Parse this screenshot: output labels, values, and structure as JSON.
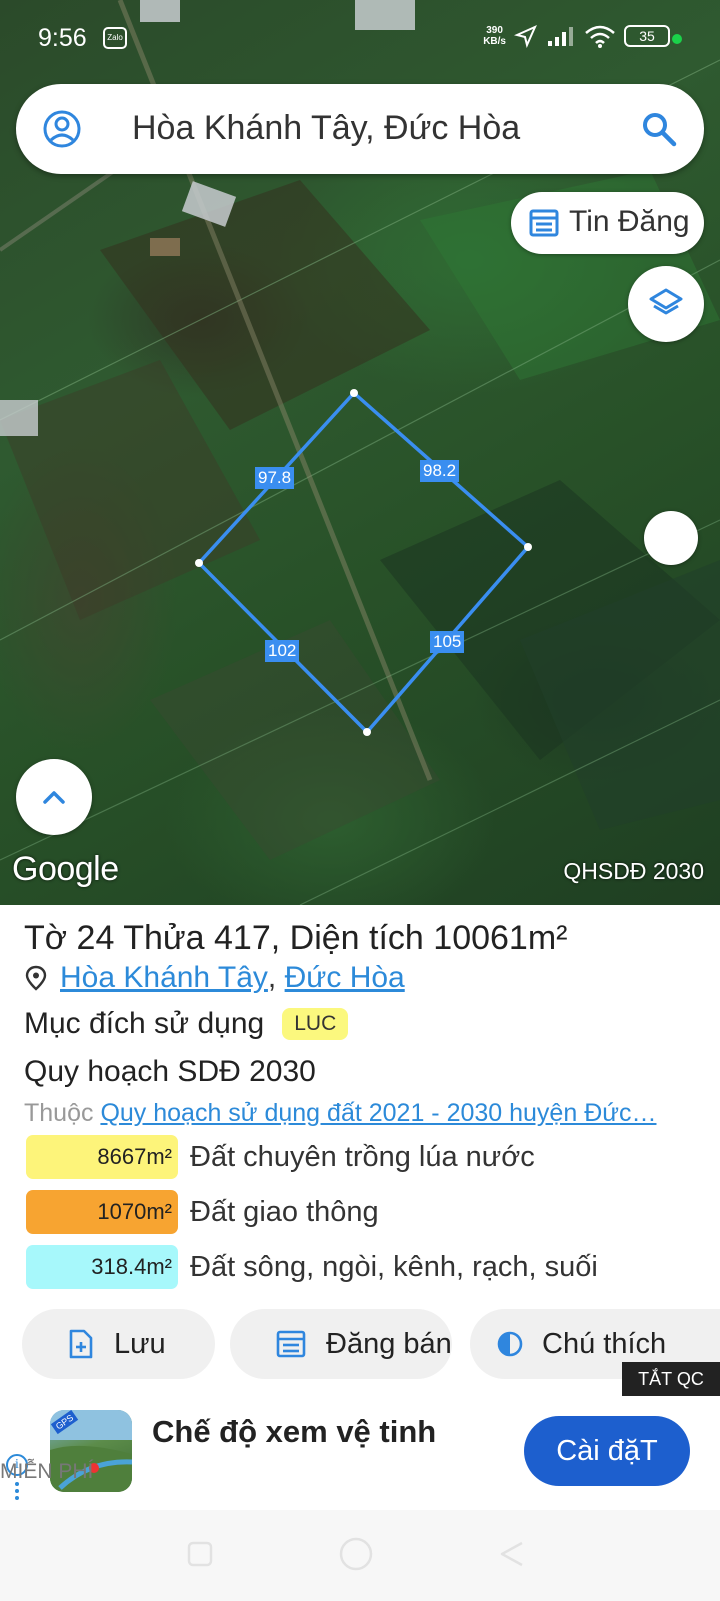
{
  "status_bar": {
    "time": "9:56",
    "app_icon_label": "Zalo",
    "net_speed_value": "390",
    "net_speed_unit": "KB/s",
    "battery": "35"
  },
  "search": {
    "text": "Hòa Khánh Tây, Đức Hòa"
  },
  "map": {
    "news_button_label": "Tin Đăng",
    "edge_labels": [
      "97.8",
      "98.2",
      "102",
      "105"
    ],
    "google_logo": "Google",
    "layer_name": "QHSDĐ 2030",
    "parcel_color": "#3a8ef0"
  },
  "parcel": {
    "sheet_prefix": "Tờ",
    "sheet_no": "24",
    "plot_prefix": "Thửa",
    "plot_no": "417",
    "area_prefix": ", Diện tích",
    "area": "10061m²",
    "commune": "Hòa Khánh Tây",
    "separator": ",",
    "district": "Đức Hòa",
    "purpose_label": "Mục đích sử dụng",
    "purpose_code": "LUC",
    "plan_title": "Quy hoạch SDĐ 2030",
    "belongs_prefix": "Thuộc",
    "belongs_link": "Quy hoạch sử dụng đất 2021 - 2030 huyện Đức…",
    "land_uses": [
      {
        "area": "8667m²",
        "label": "Đất chuyên trồng lúa nước",
        "color": "#fdf47a"
      },
      {
        "area": "1070m²",
        "label": "Đất giao thông",
        "color": "#f7a431"
      },
      {
        "area": "318.4m²",
        "label": "Đất sông, ngòi, kênh, rạch, suối",
        "color": "#a7f8fb"
      }
    ]
  },
  "actions": {
    "save": "Lưu",
    "post_sale": "Đăng bán",
    "legend": "Chú thích"
  },
  "ad": {
    "close_label": "TẮT QC",
    "title": "Chế độ xem vệ tinh",
    "subtitle": "MIỄN PHÍ",
    "install": "Cài đặT",
    "icon_badge": "GPS"
  }
}
